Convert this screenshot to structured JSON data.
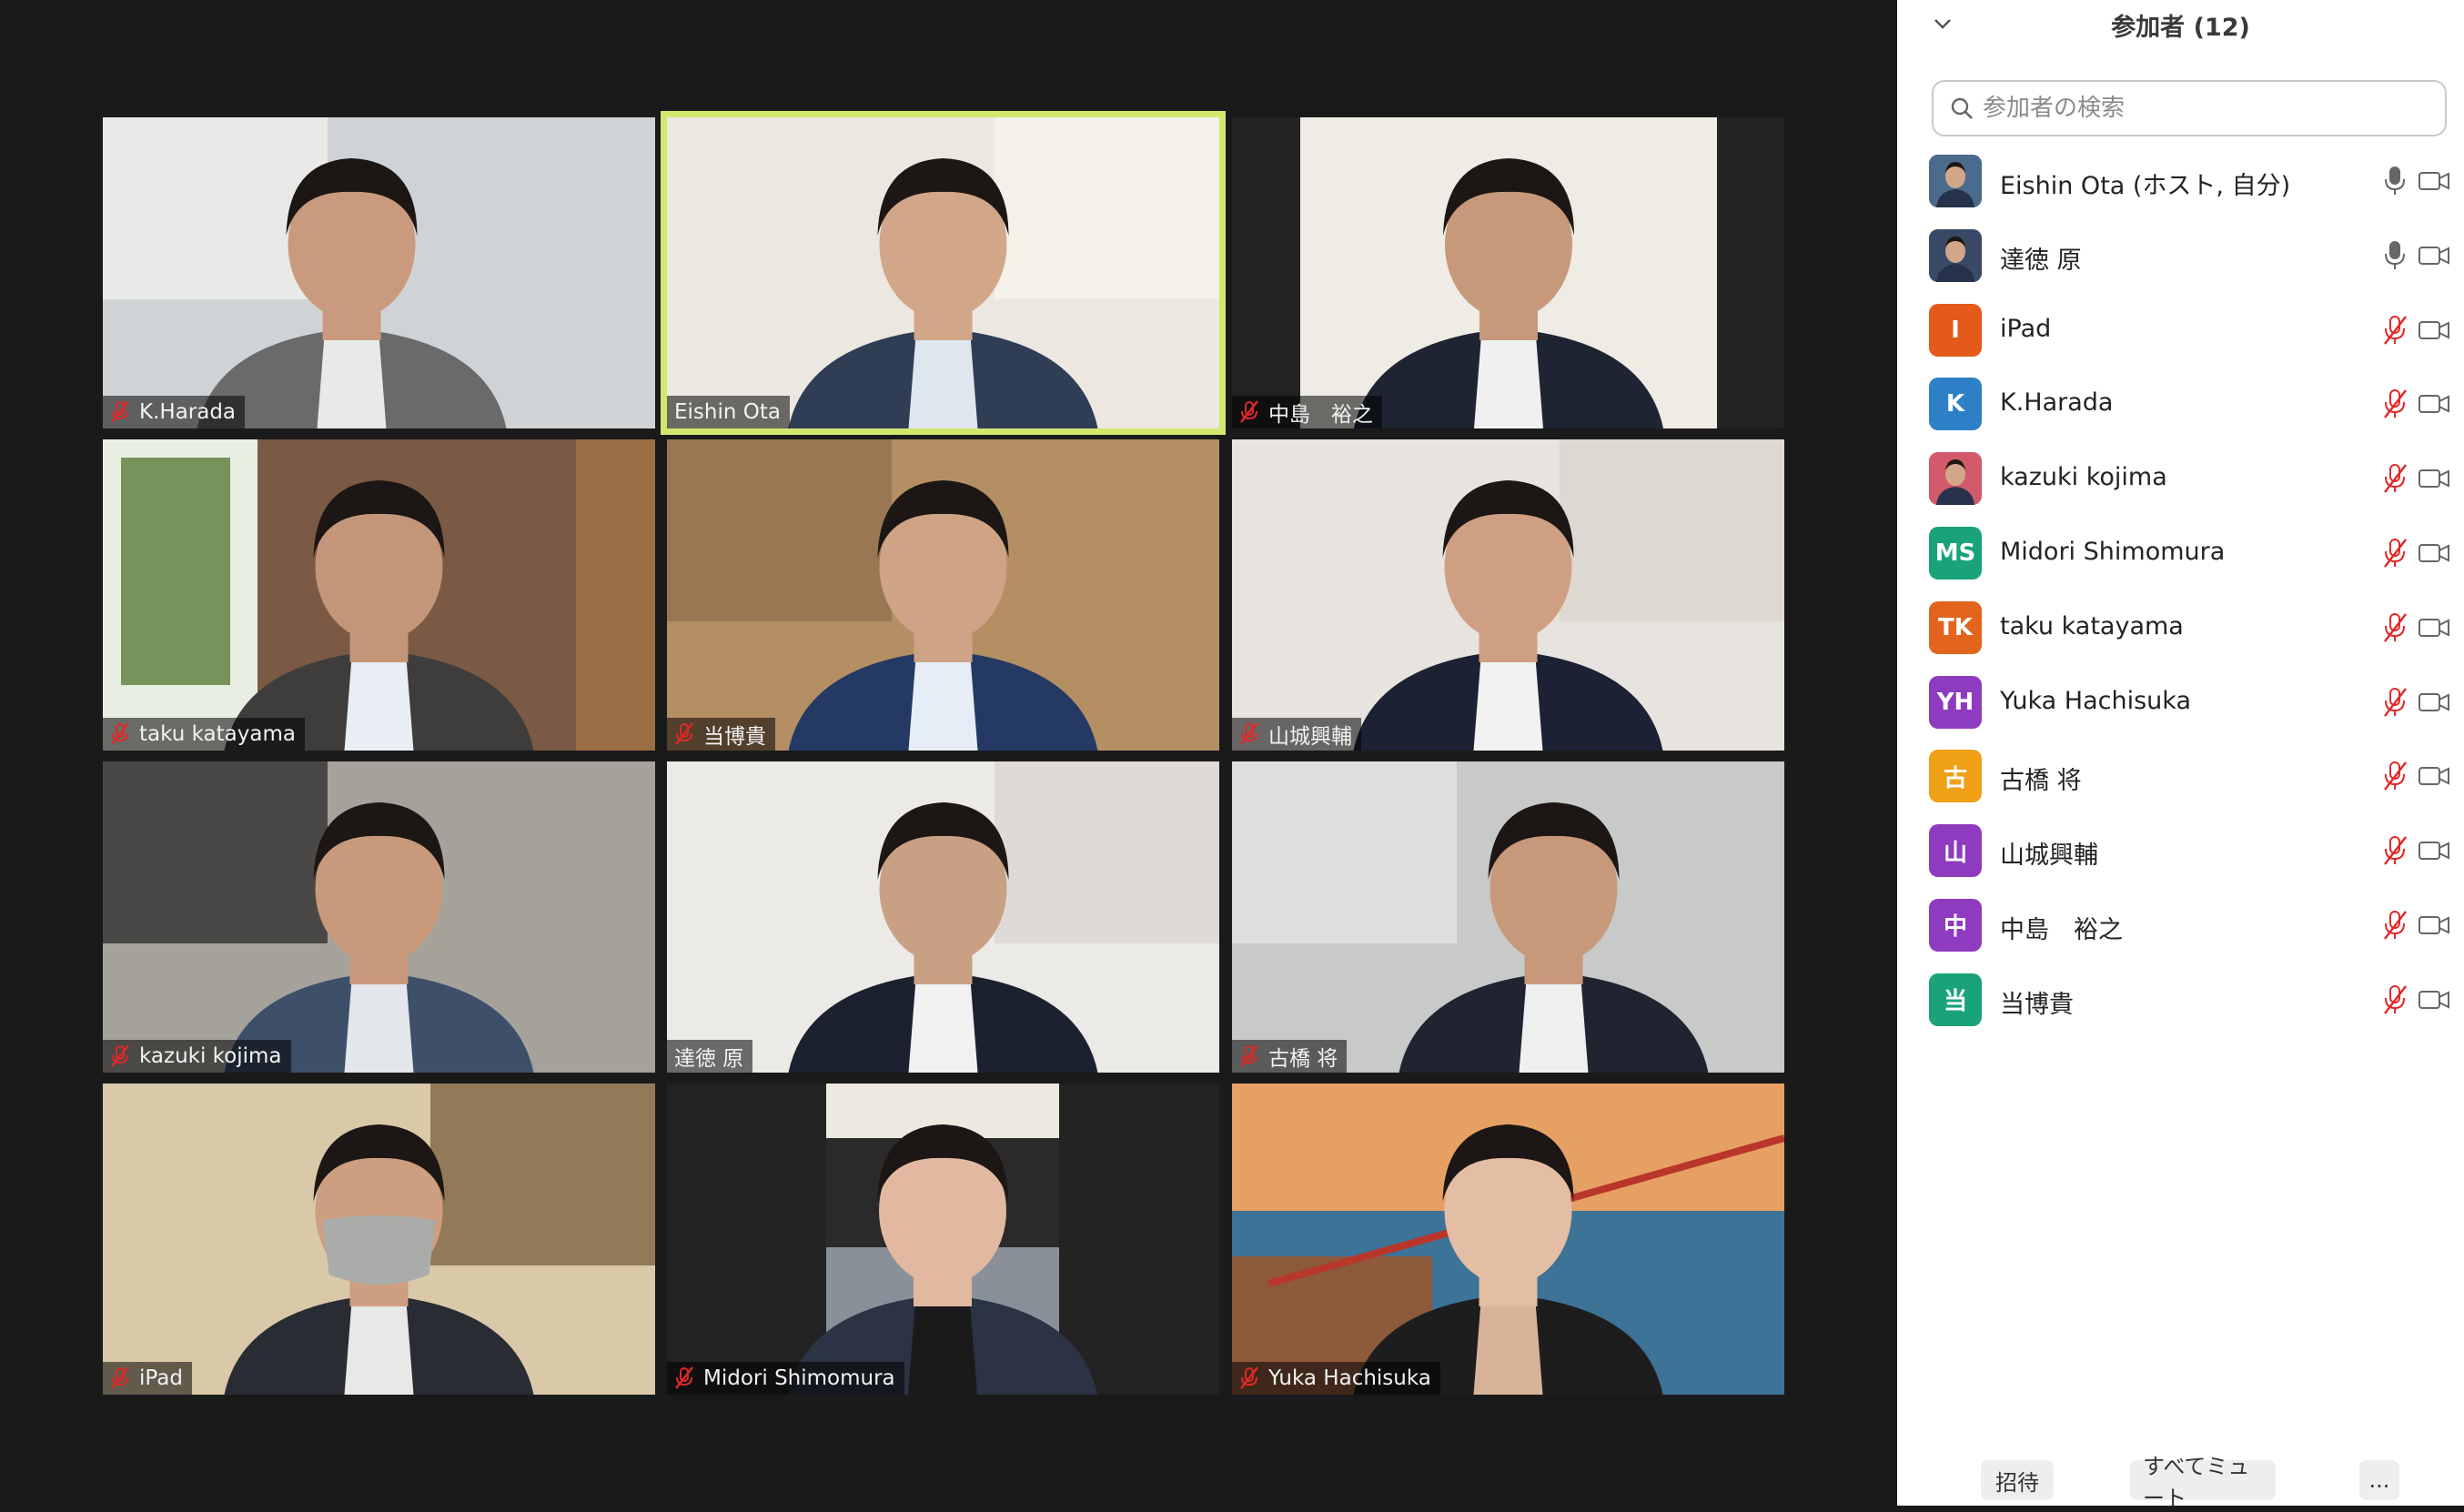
{
  "tiles": [
    {
      "name": "K.Harada",
      "muted": true
    },
    {
      "name": "Eishin Ota",
      "muted": false,
      "active": true
    },
    {
      "name": "中島　裕之",
      "muted": true
    },
    {
      "name": "taku katayama",
      "muted": true
    },
    {
      "name": "当博貴",
      "muted": true
    },
    {
      "name": "山城興輔",
      "muted": true
    },
    {
      "name": "kazuki kojima",
      "muted": true
    },
    {
      "name": "達徳 原",
      "muted": false
    },
    {
      "name": "古橋 将",
      "muted": true
    },
    {
      "name": "iPad",
      "muted": true
    },
    {
      "name": "Midori Shimomura",
      "muted": true
    },
    {
      "name": "Yuka Hachisuka",
      "muted": true
    }
  ],
  "panel": {
    "title": "参加者 (12)",
    "search_placeholder": "参加者の検索",
    "participants": [
      {
        "name": "Eishin Ota (ホスト, 自分)",
        "avatar": "photo",
        "avatar_color": "#4a6b8c",
        "muted": false
      },
      {
        "name": "達徳 原",
        "avatar": "photo",
        "avatar_color": "#3a4a66",
        "muted": false
      },
      {
        "name": "iPad",
        "avatar": "I",
        "avatar_color": "#e35a1b",
        "muted": true
      },
      {
        "name": "K.Harada",
        "avatar": "K",
        "avatar_color": "#2d7fc6",
        "muted": true
      },
      {
        "name": "kazuki kojima",
        "avatar": "photo",
        "avatar_color": "#d25a6a",
        "muted": true
      },
      {
        "name": "Midori Shimomura",
        "avatar": "MS",
        "avatar_color": "#1aa37a",
        "muted": true
      },
      {
        "name": "taku katayama",
        "avatar": "TK",
        "avatar_color": "#e3641d",
        "muted": true
      },
      {
        "name": "Yuka Hachisuka",
        "avatar": "YH",
        "avatar_color": "#8e3bbf",
        "muted": true
      },
      {
        "name": "古橋 将",
        "avatar": "古",
        "avatar_color": "#f0a017",
        "muted": true
      },
      {
        "name": "山城興輔",
        "avatar": "山",
        "avatar_color": "#8e3bbf",
        "muted": true
      },
      {
        "name": "中島　裕之",
        "avatar": "中",
        "avatar_color": "#8e3bbf",
        "muted": true
      },
      {
        "name": "当博貴",
        "avatar": "当",
        "avatar_color": "#1aa37a",
        "muted": true
      }
    ]
  },
  "footer": {
    "invite": "招待",
    "mute_all": "すべてミュート",
    "more": "..."
  },
  "colors": {
    "active_speaker": "#d2e86d",
    "muted_red": "#e02828"
  }
}
